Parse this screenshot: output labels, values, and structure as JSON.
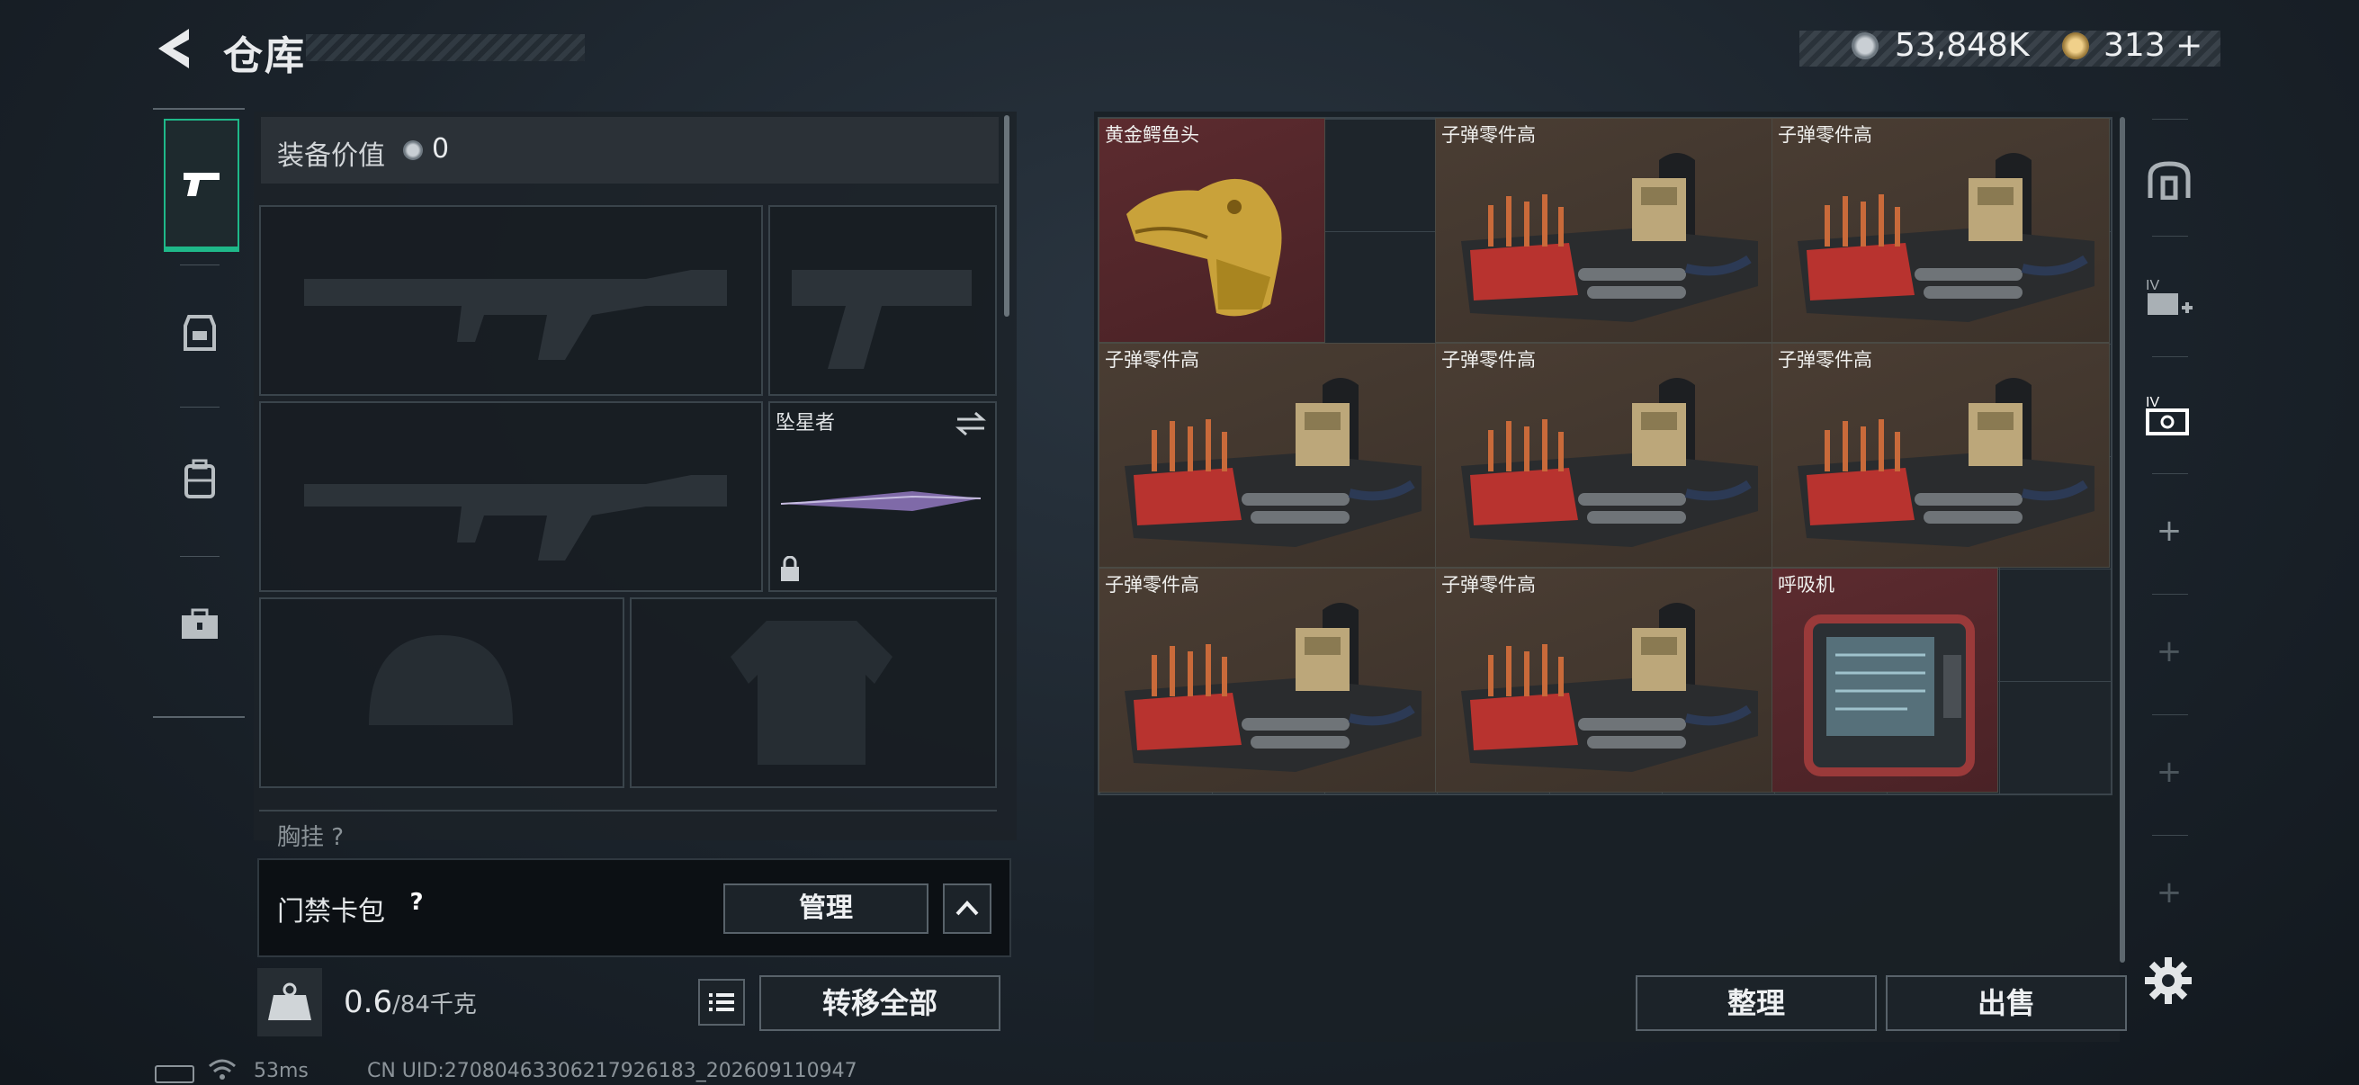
{
  "header": {
    "title": "仓库",
    "currency_primary": "53,848K",
    "currency_secondary": "313",
    "currency_secondary_add": "+"
  },
  "nav": {
    "items": [
      {
        "icon": "pistol-icon",
        "active": true
      },
      {
        "icon": "vest-icon",
        "active": false
      },
      {
        "icon": "backpack-icon",
        "active": false
      },
      {
        "icon": "toolbox-icon",
        "active": false
      }
    ]
  },
  "equipment": {
    "value_label": "装备价值",
    "value": "0",
    "melee_name": "坠星者",
    "chest_label": "胸挂 ?"
  },
  "card_bag": {
    "label": "门禁卡包",
    "help": "?",
    "manage_label": "管理"
  },
  "bottom": {
    "weight_current": "0.6",
    "weight_max": "/84千克",
    "transfer_all_label": "转移全部",
    "sort_label": "整理",
    "sell_label": "出售"
  },
  "status": {
    "ping": "53ms",
    "uid": "CN UID:27080463306217926183_202609110947"
  },
  "warehouse": {
    "items": [
      {
        "name": "黄金鳄鱼头",
        "color": "#5c2b2f",
        "icon": "golden-crocodile-head-icon"
      },
      {
        "name": "子弹零件高",
        "color": "#4a3d33",
        "icon": "ammo-parts-crate-icon"
      },
      {
        "name": "子弹零件高",
        "color": "#4a3d33",
        "icon": "ammo-parts-crate-icon"
      },
      {
        "name": "子弹零件高",
        "color": "#4a3d33",
        "icon": "ammo-parts-crate-icon"
      },
      {
        "name": "子弹零件高",
        "color": "#4a3d33",
        "icon": "ammo-parts-crate-icon"
      },
      {
        "name": "子弹零件高",
        "color": "#4a3d33",
        "icon": "ammo-parts-crate-icon"
      },
      {
        "name": "子弹零件高",
        "color": "#4a3d33",
        "icon": "ammo-parts-crate-icon"
      },
      {
        "name": "子弹零件高",
        "color": "#4a3d33",
        "icon": "ammo-parts-crate-icon"
      },
      {
        "name": "呼吸机",
        "color": "#5c2b2f",
        "icon": "respirator-device-icon"
      }
    ]
  },
  "rail": {
    "plus": "+"
  }
}
